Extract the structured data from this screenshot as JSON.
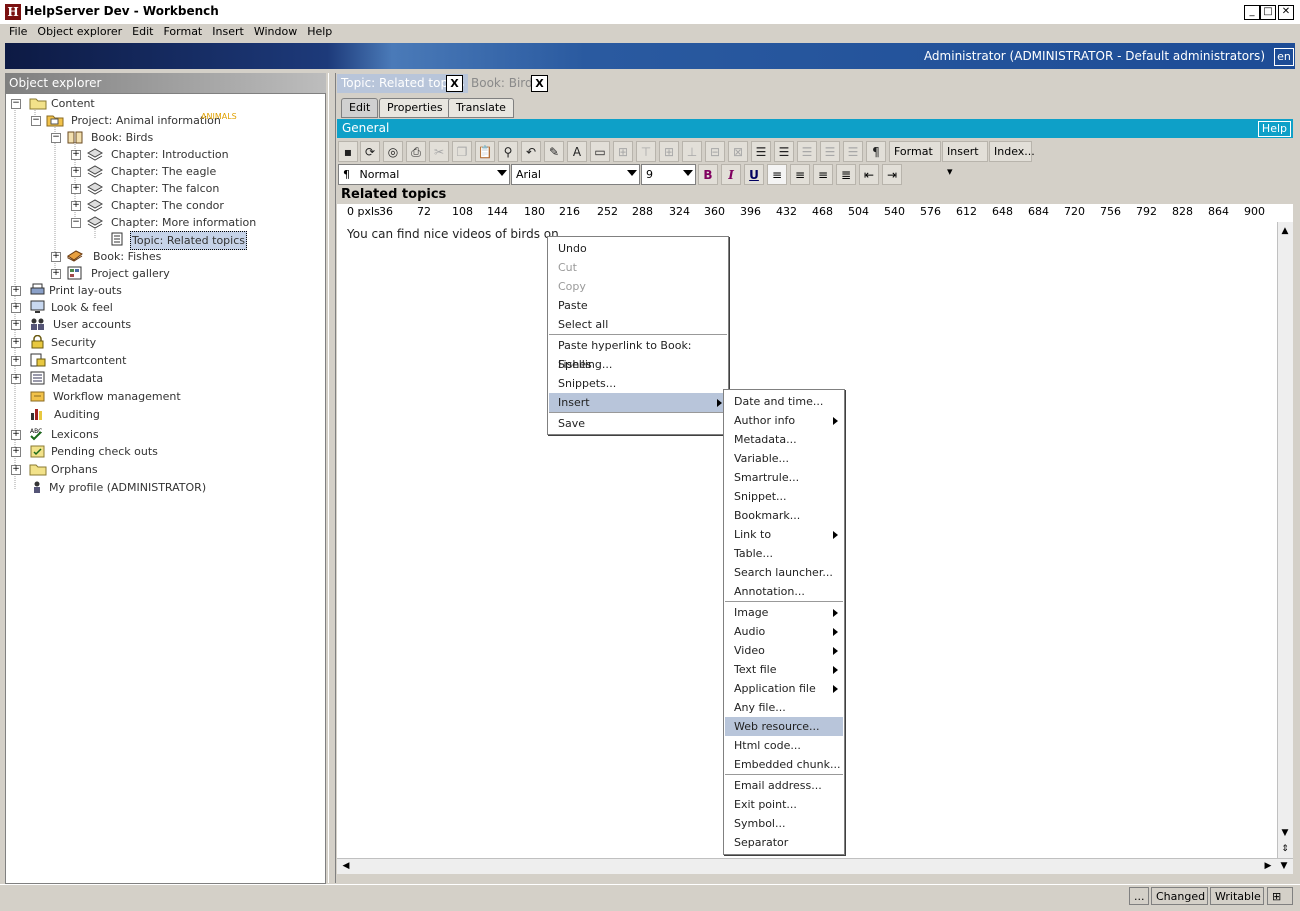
{
  "window": {
    "title": "HelpServer Dev - Workbench",
    "app_icon": "H"
  },
  "menubar": [
    "File",
    "Object explorer",
    "Edit",
    "Format",
    "Insert",
    "Window",
    "Help"
  ],
  "banner": {
    "user": "Administrator (ADMINISTRATOR - Default administrators)",
    "lang": "en"
  },
  "explorer": {
    "title": "Object explorer",
    "items": [
      {
        "label": "Content",
        "toggle": "−"
      },
      {
        "label": "Project: Animal information",
        "badge": "ANIMALS",
        "toggle": "−"
      },
      {
        "label": "Book: Birds",
        "toggle": "−"
      },
      {
        "label": "Chapter: Introduction",
        "toggle": "+"
      },
      {
        "label": "Chapter: The eagle",
        "toggle": "+"
      },
      {
        "label": "Chapter: The falcon",
        "toggle": "+"
      },
      {
        "label": "Chapter: The condor",
        "toggle": "+"
      },
      {
        "label": "Chapter: More information",
        "toggle": "−"
      },
      {
        "label": "Topic: Related topics",
        "toggle": ""
      },
      {
        "label": "Book: Fishes",
        "toggle": "+"
      },
      {
        "label": "Project gallery",
        "toggle": "+"
      },
      {
        "label": "Print lay-outs",
        "toggle": "+"
      },
      {
        "label": "Look & feel",
        "toggle": "+"
      },
      {
        "label": "User accounts",
        "toggle": "+"
      },
      {
        "label": "Security",
        "toggle": "+"
      },
      {
        "label": "Smartcontent",
        "toggle": "+"
      },
      {
        "label": "Metadata",
        "toggle": "+"
      },
      {
        "label": "Workflow management",
        "toggle": ""
      },
      {
        "label": "Auditing",
        "toggle": ""
      },
      {
        "label": "Lexicons",
        "toggle": "+"
      },
      {
        "label": "Pending check outs",
        "toggle": "+"
      },
      {
        "label": "Orphans",
        "toggle": "+"
      },
      {
        "label": "My profile (ADMINISTRATOR)",
        "toggle": ""
      }
    ]
  },
  "doc_tabs": [
    {
      "label": "Topic: Related topics",
      "close": "X"
    },
    {
      "label": "Book: Birds",
      "close": "X"
    }
  ],
  "sub_tabs": [
    "Edit",
    "Properties",
    "Translate"
  ],
  "section": {
    "title": "General",
    "help": "Help"
  },
  "toolbar": {
    "format": "Format",
    "insert": "Insert",
    "index": "Index...",
    "para_mark": "¶"
  },
  "format_bar": {
    "style": "Normal",
    "style_icon": "¶",
    "font": "Arial",
    "size": "9",
    "bold": "B",
    "italic": "I",
    "underline": "U"
  },
  "document": {
    "title": "Related topics",
    "text": "You can find nice videos of birds on"
  },
  "ruler": [
    "0 pxls",
    "36",
    "72",
    "108",
    "144",
    "180",
    "216",
    "252",
    "288",
    "324",
    "360",
    "396",
    "432",
    "468",
    "504",
    "540",
    "576",
    "612",
    "648",
    "684",
    "720",
    "756",
    "792",
    "828",
    "864",
    "900"
  ],
  "context_menu": {
    "items": [
      "Undo",
      "Cut",
      "Copy",
      "Paste",
      "Select all",
      "Paste hyperlink to Book: Fishes",
      "Spelling...",
      "Snippets...",
      "Insert",
      "Save"
    ]
  },
  "insert_menu": {
    "items": [
      "Date and time...",
      "Author info",
      "Metadata...",
      "Variable...",
      "Smartrule...",
      "Snippet...",
      "Bookmark...",
      "Link to",
      "Table...",
      "Search launcher...",
      "Annotation...",
      "Image",
      "Audio",
      "Video",
      "Text file",
      "Application file",
      "Any file...",
      "Web resource...",
      "Html code...",
      "Embedded chunk...",
      "Email address...",
      "Exit point...",
      "Symbol...",
      "Separator"
    ]
  },
  "statusbar": {
    "dots": "...",
    "changed": "Changed",
    "writable": "Writable"
  }
}
